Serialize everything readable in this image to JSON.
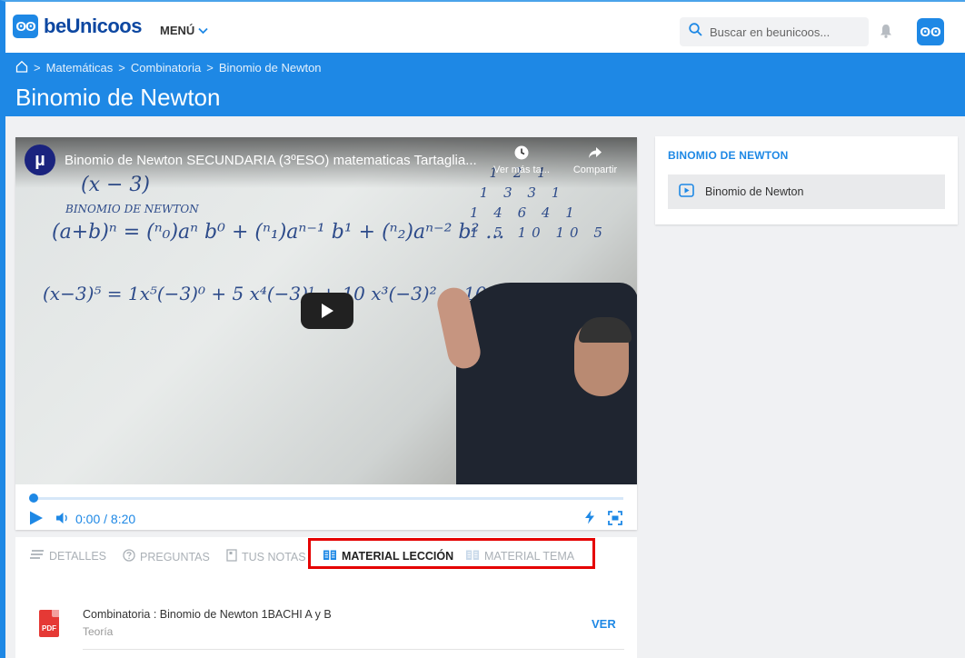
{
  "topbar": {
    "logo_mark": "ʘʘ",
    "logo_text": "beUnicoos",
    "menu_label": "MENÚ",
    "search_placeholder": "Buscar en beunicoos...",
    "avatar_mark": "ʘʘ"
  },
  "breadcrumb": {
    "items": [
      "Matemáticas",
      "Combinatoria",
      "Binomio de Newton"
    ],
    "separator": ">"
  },
  "page_title": "Binomio de Newton",
  "video": {
    "channel_mark": "µ",
    "title": "Binomio de Newton SECUNDARIA (3ºESO) matematicas Tartaglia...",
    "watch_later_label": "Ver más ta...",
    "share_label": "Compartir",
    "board": {
      "line1": "(x − 3)",
      "line2": "BINOMIO DE NEWTON",
      "line3": "(a+b)ⁿ = (ⁿ₀)aⁿ b⁰ + (ⁿ₁)aⁿ⁻¹ b¹ + (ⁿ₂)aⁿ⁻² b² ...",
      "line4": "(x−3)⁵ =  1x⁵(−3)⁰  + 5 x⁴(−3)¹ + 10 x³(−3)² + 10 x²(−3)³ + 5 x",
      "triangle": "  1 2 1\n 1 3 3 1\n1 4 6 4 1\n1 5 10 10 5"
    }
  },
  "player": {
    "time": "0:00 / 8:20",
    "progress_fraction": 0
  },
  "tabs": {
    "details": "DETALLES",
    "questions": "PREGUNTAS",
    "notes": "TUS NOTAS",
    "lesson_material": "MATERIAL LECCIÓN",
    "topic_material": "MATERIAL TEMA",
    "active": "lesson_material"
  },
  "materials": [
    {
      "icon_label": "PDF",
      "title": "Combinatoria : Binomio de Newton 1BACHI A y B",
      "subtitle": "Teoría",
      "action": "VER"
    }
  ],
  "sidebar": {
    "title": "BINOMIO DE NEWTON",
    "items": [
      {
        "label": "Binomio de Newton"
      }
    ]
  },
  "colors": {
    "brand_blue": "#1e88e5",
    "highlight_red": "#e50000",
    "pdf_red": "#e53935"
  }
}
